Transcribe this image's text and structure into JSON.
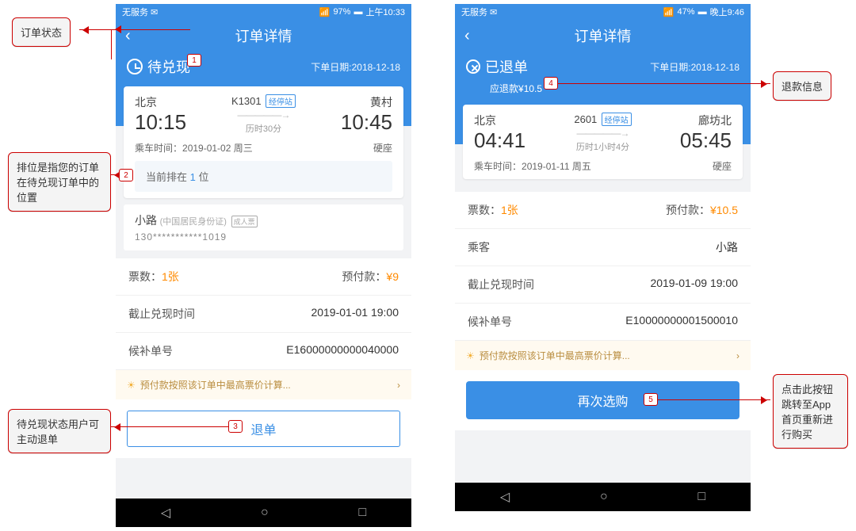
{
  "annotations": {
    "a1": "订单状态",
    "a2": "排位是指您的订单在待兑现订单中的位置",
    "a3": "待兑现状态用户可主动退单",
    "a4": "退款信息",
    "a5": "点击此按钮跳转至App首页重新进行购买"
  },
  "nums": {
    "n1": "1",
    "n2": "2",
    "n3": "3",
    "n4": "4",
    "n5": "5"
  },
  "left": {
    "status_service": "无服务",
    "status_batt": "97%",
    "status_time": "上午10:33",
    "header_title": "订单详情",
    "status_text": "待兑现",
    "order_date_prefix": "下单日期:",
    "order_date": "2018-12-18",
    "from_city": "北京",
    "from_time": "10:15",
    "train_no": "K1301",
    "via_badge": "经停站",
    "duration": "历时30分",
    "to_city": "黄村",
    "to_time": "10:45",
    "ride_label": "乘车时间：",
    "ride_value": "2019-01-02 周三",
    "seat": "硬座",
    "queue_prefix": "当前排在 ",
    "queue_num": "1",
    "queue_suffix": " 位",
    "pax_name": "小路",
    "pax_sub": "(中国居民身份证)",
    "pax_tag": "成人票",
    "pax_id": "130***********1019",
    "rows": {
      "tickets_l": "票数：",
      "tickets_v": "1张",
      "prepay_l": "预付款：",
      "prepay_v": "¥9",
      "deadline_l": "截止兑现时间",
      "deadline_v": "2019-01-01 19:00",
      "orderno_l": "候补单号",
      "orderno_v": "E16000000000040000"
    },
    "hint": "预付款按照该订单中最高票价计算...",
    "btn_cancel": "退单"
  },
  "right": {
    "status_service": "无服务",
    "status_batt": "47%",
    "status_time": "晚上9:46",
    "header_title": "订单详情",
    "status_text": "已退单",
    "order_date_prefix": "下单日期:",
    "order_date": "2018-12-18",
    "refund_label": "应退款",
    "refund_amount": "¥10.5",
    "from_city": "北京",
    "from_time": "04:41",
    "train_no": "2601",
    "via_badge": "经停站",
    "duration": "历时1小时4分",
    "to_city": "廊坊北",
    "to_time": "05:45",
    "ride_label": "乘车时间：",
    "ride_value": "2019-01-11 周五",
    "seat": "硬座",
    "rows": {
      "tickets_l": "票数：",
      "tickets_v": "1张",
      "prepay_l": "预付款：",
      "prepay_v": "¥10.5",
      "pax_l": "乘客",
      "pax_v": "小路",
      "deadline_l": "截止兑现时间",
      "deadline_v": "2019-01-09 19:00",
      "orderno_l": "候补单号",
      "orderno_v": "E10000000001500010"
    },
    "hint": "预付款按照该订单中最高票价计算...",
    "btn_rebuy": "再次选购"
  },
  "icons": {
    "chevron": "›"
  }
}
